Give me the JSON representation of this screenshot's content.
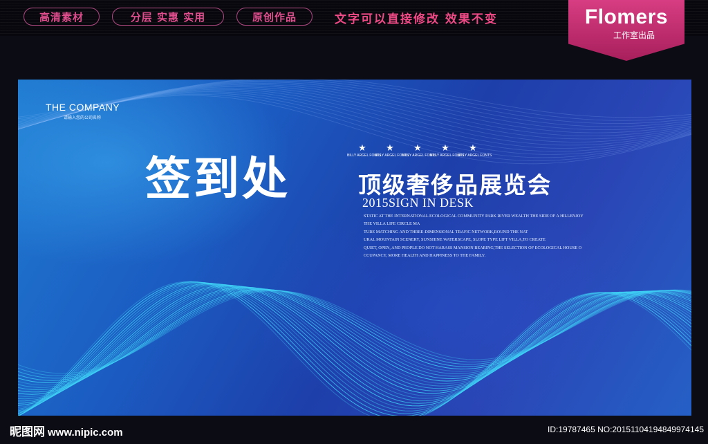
{
  "top_banner": {
    "tags": [
      "高清素材",
      "分层 实惠 实用",
      "原创作品"
    ],
    "slogan": "文字可以直接修改  效果不变",
    "brand_name": "Flomers",
    "brand_sub": "工作室出品",
    "brand_color": "#c52c6e",
    "tag_color": "#e04e8e"
  },
  "poster": {
    "company_name": "THE COMPANY",
    "company_sub": "请输入您的公司名称",
    "main_title": "签到处",
    "subtitle": "顶级奢侈品展览会",
    "star_label": "BILLY ARGEL FONTS",
    "star_icon": "star-icon",
    "english_title": "2015SIGN IN DESK",
    "paragraph": [
      "STATIC AT THE INTERNATIONAL ECOLOGICAL COMMUNITY PARK RIVER WEALTH THE SIDE OF A HILLENJOY",
      "THE VILLA LIFE CIRCLE MA",
      "TURE MATCHING AND THREE-DIMENSIONAL TRAFIC NETWORK,ROUND THE NAT",
      "URAL MOUNTAIN SCENERY, SUNSHINE WATERSCAPE, SLOPE TYPE LIFT VILLA,TO CREATE",
      "QUIET, OPEN, AND PEOPLE DO NOT HARASS MANSION BEARING,THE SELECTION OF ECOLOGICAL HOUSE O",
      "CCUPANCY, MORE HEALTH AND HAPPINESS TO THE FAMILY."
    ],
    "colors": {
      "background": "#1d4fb8",
      "wave": "#3fd0f5"
    }
  },
  "footer": {
    "site_name": "昵图网",
    "site_url": "www.nipic.com",
    "image_id": "ID:19787465 NO:20151104194849974145"
  }
}
